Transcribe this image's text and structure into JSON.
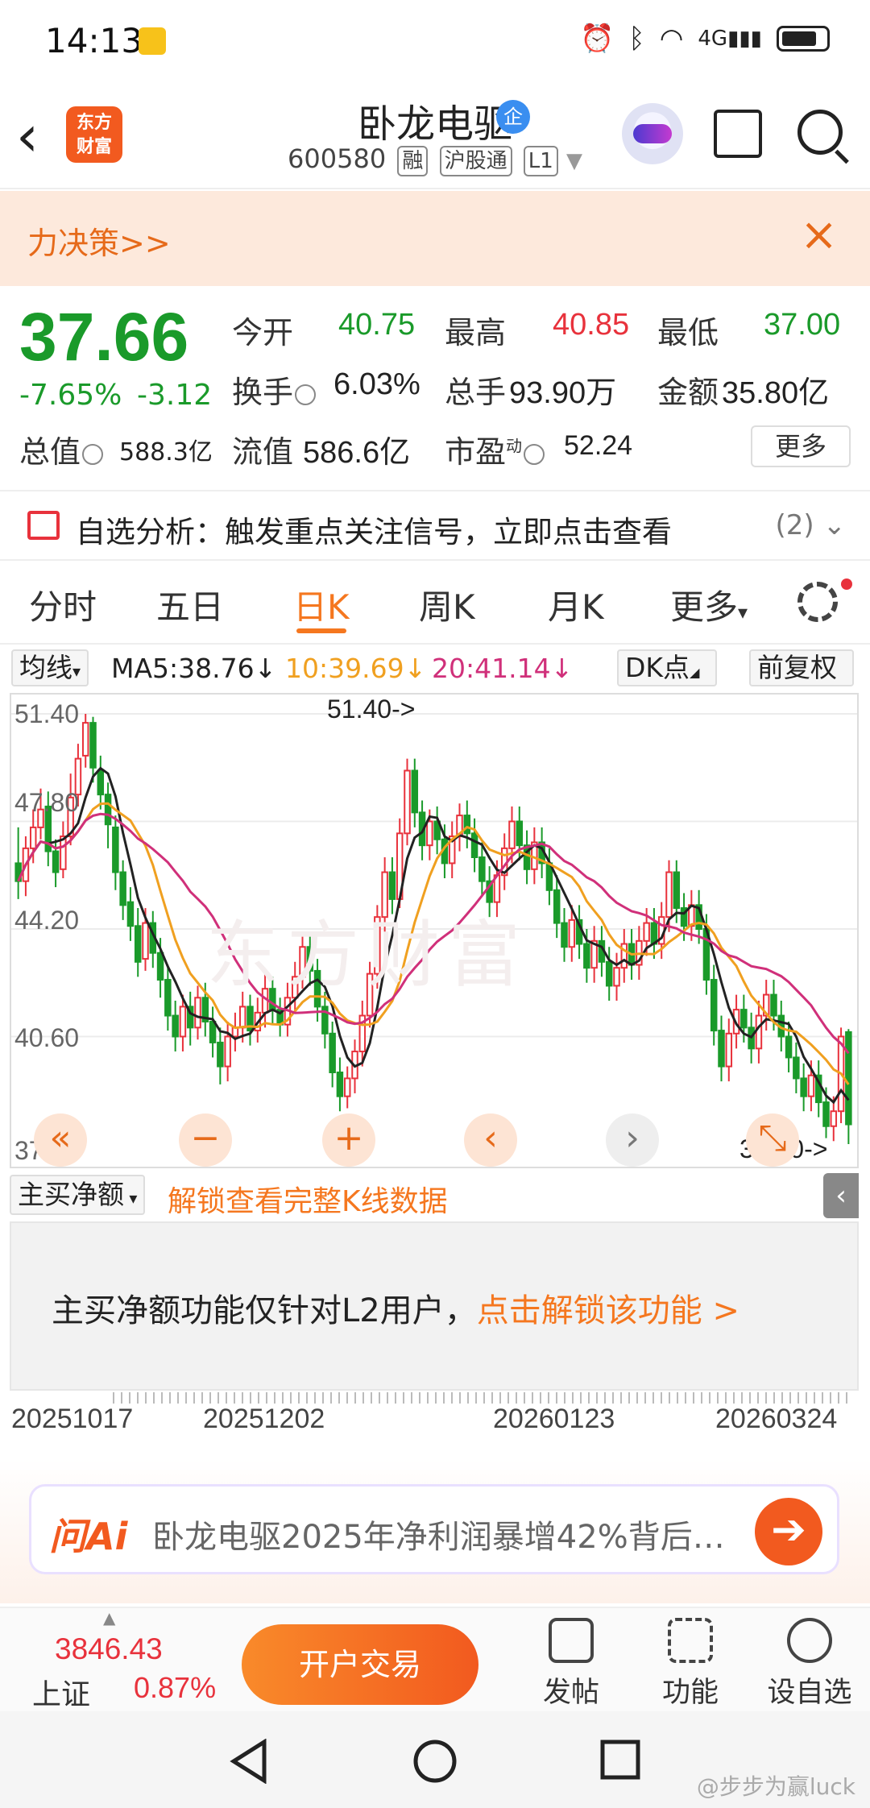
{
  "status": {
    "time": "14:13",
    "network": "4G"
  },
  "header": {
    "logo_line1": "东方",
    "logo_line2": "财富",
    "stock_name": "卧龙电驱",
    "badge": "企",
    "stock_code": "600580",
    "tags": [
      "融",
      "沪股通",
      "L1"
    ]
  },
  "banner": {
    "text": "力决策>>",
    "close": "×"
  },
  "quote": {
    "price": "37.66",
    "change_pct": "-7.65%",
    "change": "-3.12",
    "open_label": "今开",
    "open": "40.75",
    "high_label": "最高",
    "high": "40.85",
    "low_label": "最低",
    "low": "37.00",
    "turnover_label": "换手",
    "turnover": "6.03%",
    "volume_label": "总手",
    "volume": "93.90万",
    "amount_label": "金额",
    "amount": "35.80亿",
    "mktcap_label": "总值",
    "mktcap": "588.3亿",
    "float_label": "流值",
    "float": "586.6亿",
    "pe_label": "市盈",
    "pe_sup": "动",
    "pe": "52.24",
    "more_label": "更多"
  },
  "analysis": {
    "text": "自选分析：触发重点关注信号，立即点击查看",
    "count": "(2)"
  },
  "tabs": [
    "分时",
    "五日",
    "日K",
    "周K",
    "月K",
    "更多"
  ],
  "active_tab": "日K",
  "ma_row": {
    "selector": "均线",
    "ma5": "MA5:38.76↓",
    "ma10": "10:39.69↓",
    "ma20": "20:41.14↓",
    "dk": "DK点",
    "adjust": "前复权",
    "colors": {
      "ma5": "#222222",
      "ma10": "#f0a020",
      "ma20": "#d0307a"
    }
  },
  "chart_data": {
    "type": "candlestick",
    "y_labels": [
      "51.40",
      "47.80",
      "44.20",
      "40.60",
      "37.00"
    ],
    "ylim": [
      37.0,
      51.4
    ],
    "max_marker": "51.40->",
    "min_marker": "37.00->",
    "x_labels": [
      "20251017",
      "20251202",
      "20260123",
      "20260324"
    ],
    "candles": [
      [
        46.4,
        45.8,
        47.6,
        45.2
      ],
      [
        45.8,
        46.9,
        47.3,
        45.3
      ],
      [
        46.9,
        47.6,
        48.2,
        46.4
      ],
      [
        47.6,
        48.2,
        48.9,
        47.2
      ],
      [
        48.3,
        46.8,
        48.8,
        46.3
      ],
      [
        46.8,
        46.1,
        47.2,
        45.6
      ],
      [
        46.2,
        47.3,
        47.8,
        45.9
      ],
      [
        47.3,
        48.6,
        49.4,
        47.0
      ],
      [
        48.7,
        49.9,
        50.4,
        48.3
      ],
      [
        50.0,
        51.1,
        51.4,
        49.6
      ],
      [
        51.1,
        49.6,
        51.3,
        49.1
      ],
      [
        49.5,
        48.7,
        50.0,
        48.2
      ],
      [
        48.7,
        47.7,
        49.1,
        46.9
      ],
      [
        47.6,
        46.1,
        48.0,
        45.5
      ],
      [
        46.1,
        45.0,
        46.5,
        44.5
      ],
      [
        45.1,
        44.3,
        45.6,
        43.8
      ],
      [
        44.3,
        43.1,
        44.9,
        42.6
      ],
      [
        43.2,
        44.4,
        44.9,
        42.8
      ],
      [
        44.4,
        43.4,
        44.8,
        42.9
      ],
      [
        43.4,
        42.5,
        43.9,
        41.9
      ],
      [
        42.5,
        41.3,
        43.0,
        40.8
      ],
      [
        41.3,
        40.6,
        41.8,
        40.1
      ],
      [
        40.6,
        41.6,
        42.0,
        40.1
      ],
      [
        41.6,
        40.9,
        42.1,
        40.3
      ],
      [
        40.9,
        41.9,
        42.3,
        40.5
      ],
      [
        41.9,
        41.1,
        42.4,
        40.6
      ],
      [
        41.1,
        40.4,
        41.6,
        39.9
      ],
      [
        40.4,
        39.6,
        40.9,
        39.0
      ],
      [
        39.6,
        40.6,
        41.1,
        39.1
      ],
      [
        40.6,
        40.9,
        41.4,
        40.1
      ],
      [
        40.9,
        41.6,
        42.1,
        40.4
      ],
      [
        41.6,
        40.8,
        42.0,
        40.3
      ],
      [
        40.8,
        41.4,
        41.9,
        40.4
      ],
      [
        41.4,
        42.2,
        42.7,
        40.9
      ],
      [
        42.2,
        41.5,
        42.6,
        41.0
      ],
      [
        41.5,
        41.0,
        41.9,
        40.6
      ],
      [
        41.0,
        41.9,
        42.4,
        40.6
      ],
      [
        41.9,
        42.6,
        43.1,
        41.4
      ],
      [
        42.6,
        43.6,
        44.1,
        42.2
      ],
      [
        43.6,
        42.8,
        44.0,
        42.3
      ],
      [
        42.8,
        41.6,
        43.2,
        41.1
      ],
      [
        41.6,
        40.7,
        42.1,
        40.2
      ],
      [
        40.7,
        39.4,
        41.1,
        38.9
      ],
      [
        39.4,
        38.6,
        39.9,
        38.1
      ],
      [
        38.6,
        39.2,
        39.6,
        38.2
      ],
      [
        39.2,
        40.1,
        40.5,
        38.7
      ],
      [
        40.1,
        41.3,
        41.8,
        39.6
      ],
      [
        41.3,
        42.7,
        43.1,
        40.9
      ],
      [
        42.7,
        44.6,
        45.0,
        42.2
      ],
      [
        44.6,
        46.1,
        46.6,
        44.1
      ],
      [
        46.1,
        45.2,
        46.6,
        44.7
      ],
      [
        45.2,
        47.4,
        47.9,
        44.9
      ],
      [
        47.4,
        49.5,
        49.9,
        47.0
      ],
      [
        49.5,
        48.1,
        49.9,
        47.6
      ],
      [
        48.1,
        47.0,
        48.5,
        46.5
      ],
      [
        47.0,
        47.8,
        48.2,
        46.5
      ],
      [
        47.8,
        47.2,
        48.3,
        46.7
      ],
      [
        47.2,
        46.4,
        47.7,
        45.9
      ],
      [
        46.4,
        47.3,
        47.8,
        45.9
      ],
      [
        47.3,
        48.0,
        48.4,
        46.8
      ],
      [
        48.0,
        47.4,
        48.5,
        46.9
      ],
      [
        47.4,
        46.6,
        47.9,
        46.1
      ],
      [
        46.6,
        45.8,
        47.1,
        45.3
      ],
      [
        45.8,
        45.1,
        46.3,
        44.6
      ],
      [
        45.1,
        46.0,
        46.5,
        44.6
      ],
      [
        46.0,
        46.9,
        47.4,
        45.5
      ],
      [
        46.9,
        47.8,
        48.3,
        46.4
      ],
      [
        47.8,
        47.0,
        48.3,
        46.5
      ],
      [
        47.0,
        46.2,
        47.5,
        45.7
      ],
      [
        46.2,
        47.1,
        47.6,
        45.7
      ],
      [
        47.1,
        46.4,
        47.6,
        45.9
      ],
      [
        46.4,
        45.5,
        46.9,
        45.0
      ],
      [
        45.5,
        44.4,
        46.0,
        43.9
      ],
      [
        44.4,
        43.6,
        44.9,
        43.1
      ],
      [
        43.6,
        44.5,
        45.0,
        43.1
      ],
      [
        44.5,
        43.7,
        45.0,
        43.2
      ],
      [
        43.7,
        42.9,
        44.2,
        42.4
      ],
      [
        42.9,
        43.8,
        44.3,
        42.4
      ],
      [
        43.8,
        43.1,
        44.3,
        42.6
      ],
      [
        43.1,
        42.3,
        43.6,
        41.8
      ],
      [
        42.3,
        42.9,
        43.4,
        41.8
      ],
      [
        42.9,
        43.7,
        44.2,
        42.4
      ],
      [
        43.7,
        43.0,
        44.2,
        42.5
      ],
      [
        43.0,
        43.8,
        44.3,
        42.5
      ],
      [
        43.8,
        44.4,
        44.9,
        43.3
      ],
      [
        44.4,
        43.7,
        44.9,
        43.2
      ],
      [
        43.7,
        44.6,
        45.1,
        43.2
      ],
      [
        44.6,
        46.1,
        46.5,
        44.1
      ],
      [
        46.1,
        44.9,
        46.5,
        44.4
      ],
      [
        44.9,
        44.3,
        45.4,
        43.8
      ],
      [
        44.3,
        45.0,
        45.5,
        43.8
      ],
      [
        45.0,
        44.2,
        45.5,
        43.7
      ],
      [
        44.2,
        42.5,
        44.7,
        42.0
      ],
      [
        42.5,
        40.8,
        43.0,
        40.3
      ],
      [
        40.8,
        39.6,
        41.3,
        39.1
      ],
      [
        39.6,
        40.7,
        41.2,
        39.1
      ],
      [
        40.7,
        41.5,
        42.0,
        40.2
      ],
      [
        41.5,
        40.9,
        42.0,
        40.4
      ],
      [
        40.9,
        40.2,
        41.4,
        39.7
      ],
      [
        40.2,
        41.3,
        41.8,
        39.7
      ],
      [
        41.3,
        42.0,
        42.5,
        40.8
      ],
      [
        42.0,
        41.3,
        42.5,
        40.8
      ],
      [
        41.3,
        40.6,
        41.8,
        40.1
      ],
      [
        40.6,
        39.9,
        41.1,
        39.4
      ],
      [
        39.9,
        39.2,
        40.4,
        38.7
      ],
      [
        39.2,
        38.6,
        39.7,
        38.1
      ],
      [
        38.6,
        39.3,
        39.8,
        38.1
      ],
      [
        39.3,
        38.4,
        39.8,
        37.9
      ],
      [
        38.4,
        37.6,
        38.9,
        37.2
      ],
      [
        37.6,
        38.1,
        38.6,
        37.1
      ],
      [
        38.1,
        40.6,
        40.9,
        37.7
      ],
      [
        40.75,
        37.66,
        40.85,
        37.0
      ]
    ]
  },
  "nav_buttons": [
    "«",
    "−",
    "+",
    "‹",
    "›",
    "⤡"
  ],
  "indicator": {
    "selector": "主买净额",
    "unlock": "解锁查看完整K线数据",
    "message": "主买净额功能仅针对L2用户，",
    "link": "点击解锁该功能 >"
  },
  "ai": {
    "logo": "问Ai",
    "text": "卧龙电驱2025年净利润暴增42%背后…",
    "send": "➔"
  },
  "bottom": {
    "index_value": "3846.43",
    "index_name": "上证",
    "index_pct": "0.87%",
    "trade": "开户交易",
    "post": "发帖",
    "func": "功能",
    "watch": "设自选"
  },
  "watermark": "@步步为赢luck",
  "watermark_mid": "东方财富"
}
